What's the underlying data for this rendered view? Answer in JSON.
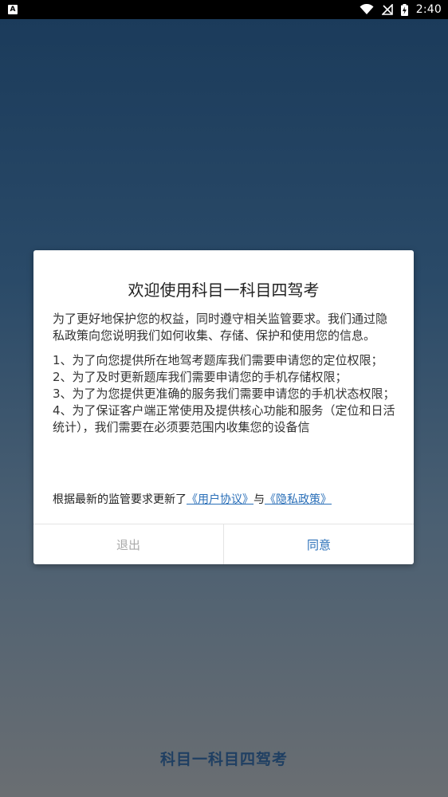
{
  "status_bar": {
    "left_icon_letter": "A",
    "time": "2:40"
  },
  "dialog": {
    "title": "欢迎使用科目一科目四驾考",
    "intro": "为了更好地保护您的权益，同时遵守相关监管要求。我们通过隐私政策向您说明我们如何收集、存储、保护和使用您的信息。",
    "items": [
      "1、为了向您提供所在地驾考题库我们需要申请您的定位权限；",
      "2、为了及时更新题库我们需要申请您的手机存储权限；",
      "3、为了为您提供更准确的服务我们需要申请您的手机状态权限；",
      "4、为了保证客户端正常使用及提供核心功能和服务（定位和日活统计），我们需要在必须要范围内收集您的设备信"
    ],
    "notice_prefix": "根据最新的监管要求更新了",
    "user_agreement_link": "《用户协议》",
    "notice_and": "与",
    "privacy_policy_link": "《隐私政策》",
    "exit_label": "退出",
    "agree_label": "同意"
  },
  "app_name": "科目一科目四驾考"
}
